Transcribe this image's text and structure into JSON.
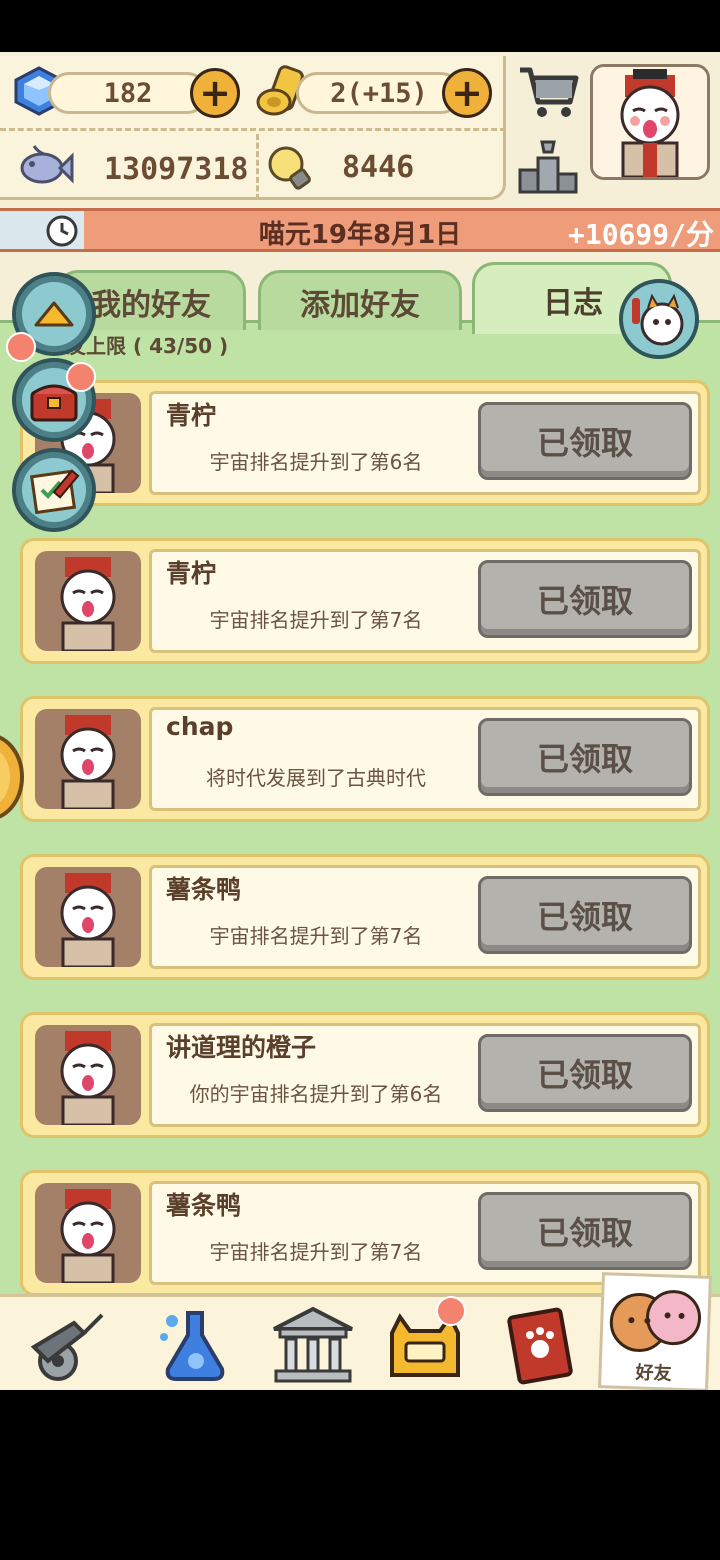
{
  "resources": {
    "gems": "182",
    "tickets": "2(+15)",
    "fish": "13097318",
    "ideas": "8446"
  },
  "date_bar": {
    "date": "喵元19年8月1日",
    "rate": "+10699/分"
  },
  "tabs": [
    {
      "label": "我的好友",
      "active": false
    },
    {
      "label": "添加好友",
      "active": false
    },
    {
      "label": "日志",
      "active": true
    }
  ],
  "friend_limit": "友上限 ( 43/50 )",
  "logs": [
    {
      "name": "青柠",
      "message": "宇宙排名提升到了第6名",
      "button": "已领取"
    },
    {
      "name": "青柠",
      "message": "宇宙排名提升到了第7名",
      "button": "已领取"
    },
    {
      "name": "chap",
      "message": "将时代发展到了古典时代",
      "button": "已领取"
    },
    {
      "name": "薯条鸭",
      "message": "宇宙排名提升到了第7名",
      "button": "已领取"
    },
    {
      "name": "讲道理的橙子",
      "message": "你的宇宙排名提升到了第6名",
      "button": "已领取"
    },
    {
      "name": "薯条鸭",
      "message": "宇宙排名提升到了第7名",
      "button": "已领取"
    }
  ],
  "bottom_nav": {
    "friends_label": "好友"
  },
  "colors": {
    "date_bar": "#ee9c79",
    "content_bg": "#bfe3a4",
    "card_bg": "#fbe9a2",
    "claimed_button": "#b4b2ad"
  }
}
